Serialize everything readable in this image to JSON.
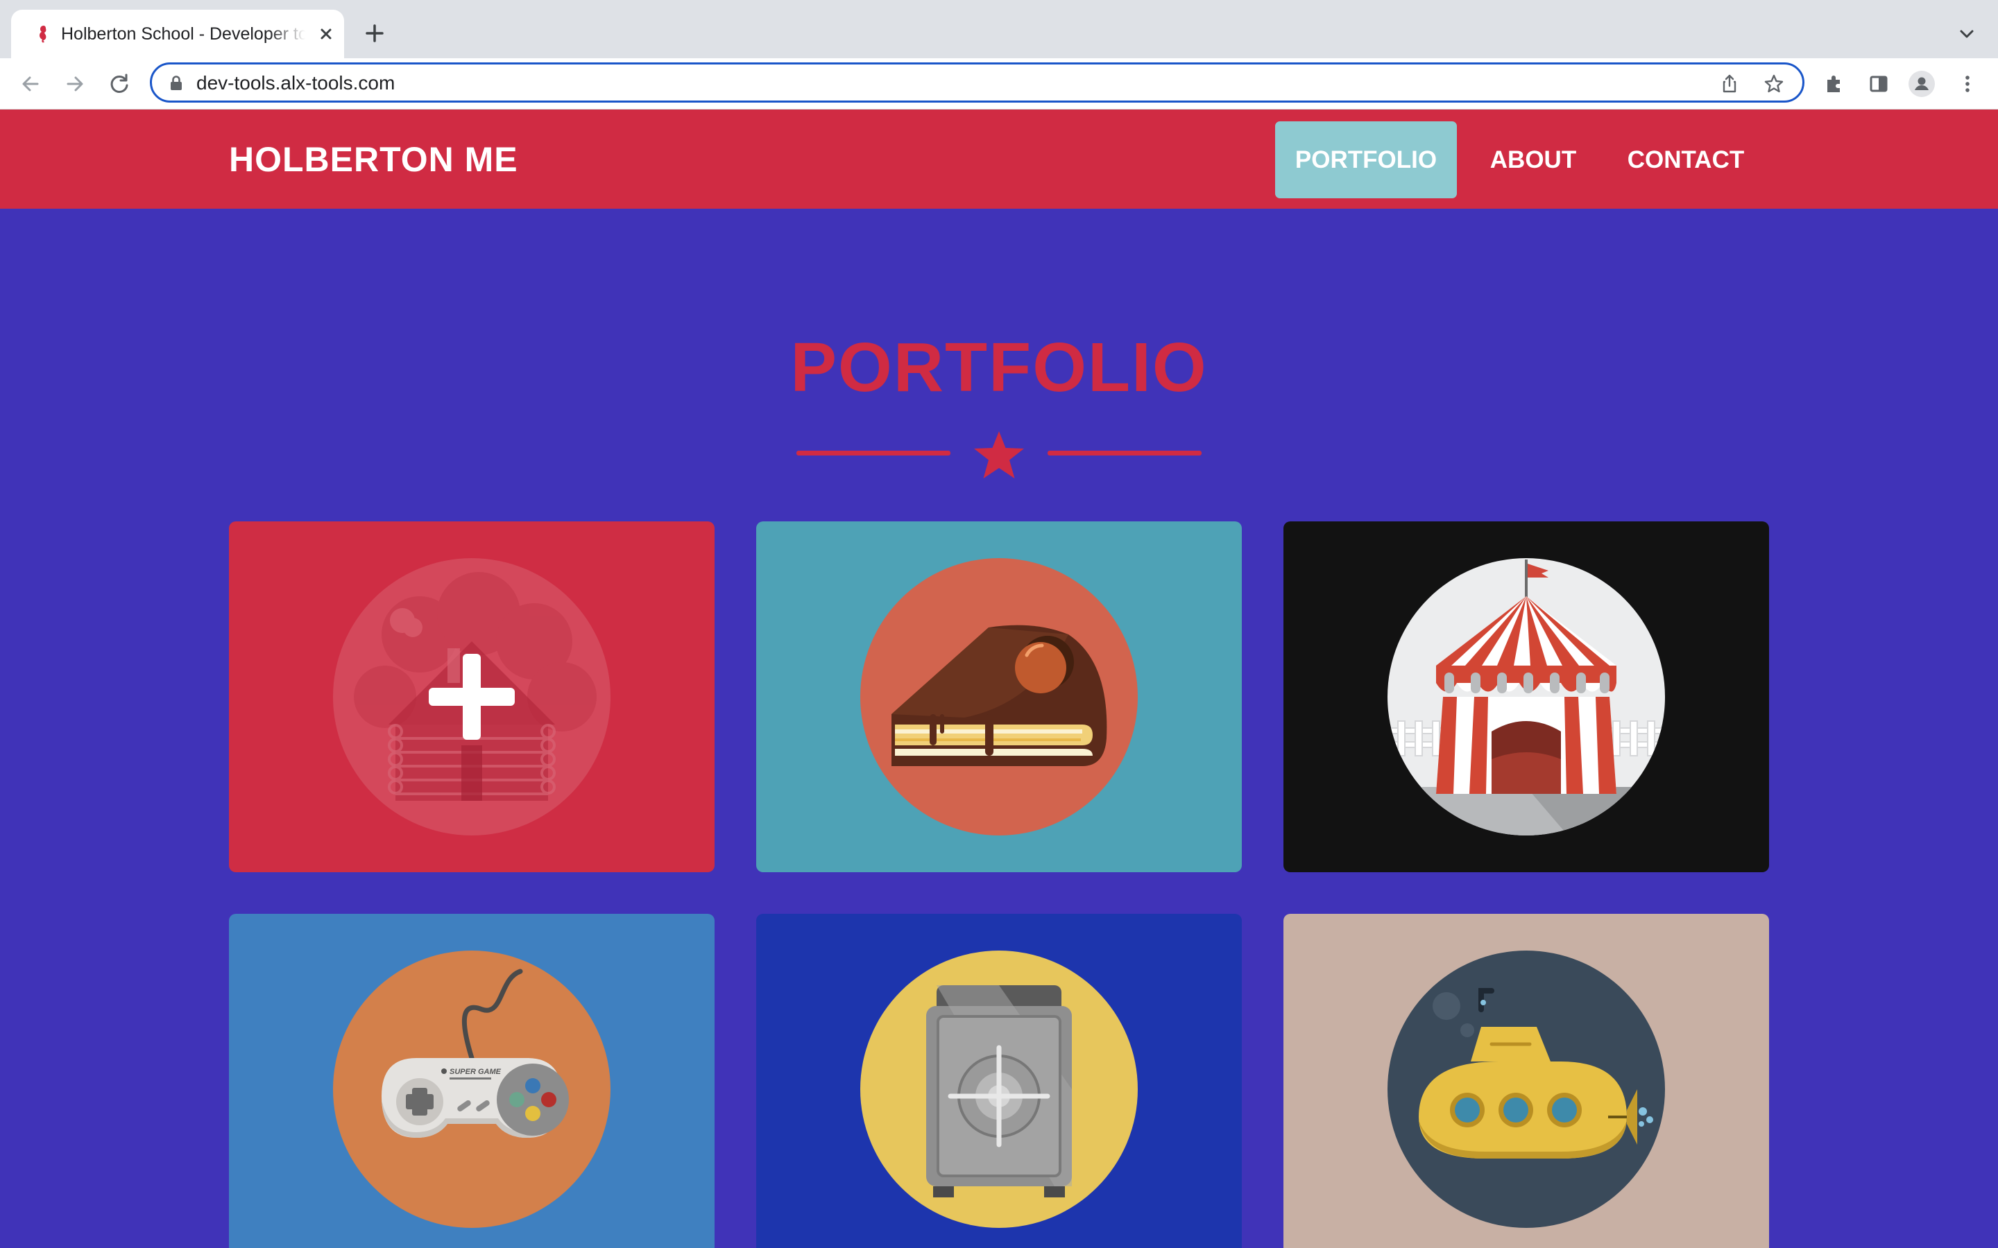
{
  "browser": {
    "tab_title": "Holberton School - Developer tools",
    "url": "dev-tools.alx-tools.com"
  },
  "site": {
    "brand": "HOLBERTON ME",
    "nav": {
      "portfolio": "PORTFOLIO",
      "about": "ABOUT",
      "contact": "CONTACT"
    }
  },
  "portfolio": {
    "title": "PORTFOLIO",
    "items": [
      {
        "icon": "log-cabin-icon",
        "bg": "#cf2d44",
        "circle": "#c73a4e"
      },
      {
        "icon": "cake-slice-icon",
        "bg": "#4ea2b6",
        "circle": "#d2644e"
      },
      {
        "icon": "circus-tent-icon",
        "bg": "#121212",
        "circle": "#ecedee"
      },
      {
        "icon": "game-controller-icon",
        "bg": "#3f80c0",
        "circle": "#d3804b"
      },
      {
        "icon": "safe-icon",
        "bg": "#1d35ad",
        "circle": "#e7c65c"
      },
      {
        "icon": "submarine-icon",
        "bg": "#c8b0a4",
        "circle": "#3a4a5a"
      }
    ],
    "controller_label": "SUPER GAME"
  },
  "colors": {
    "brand_red": "#d02b43",
    "page_bg": "#4033b8",
    "active_nav": "#8ecad1"
  }
}
